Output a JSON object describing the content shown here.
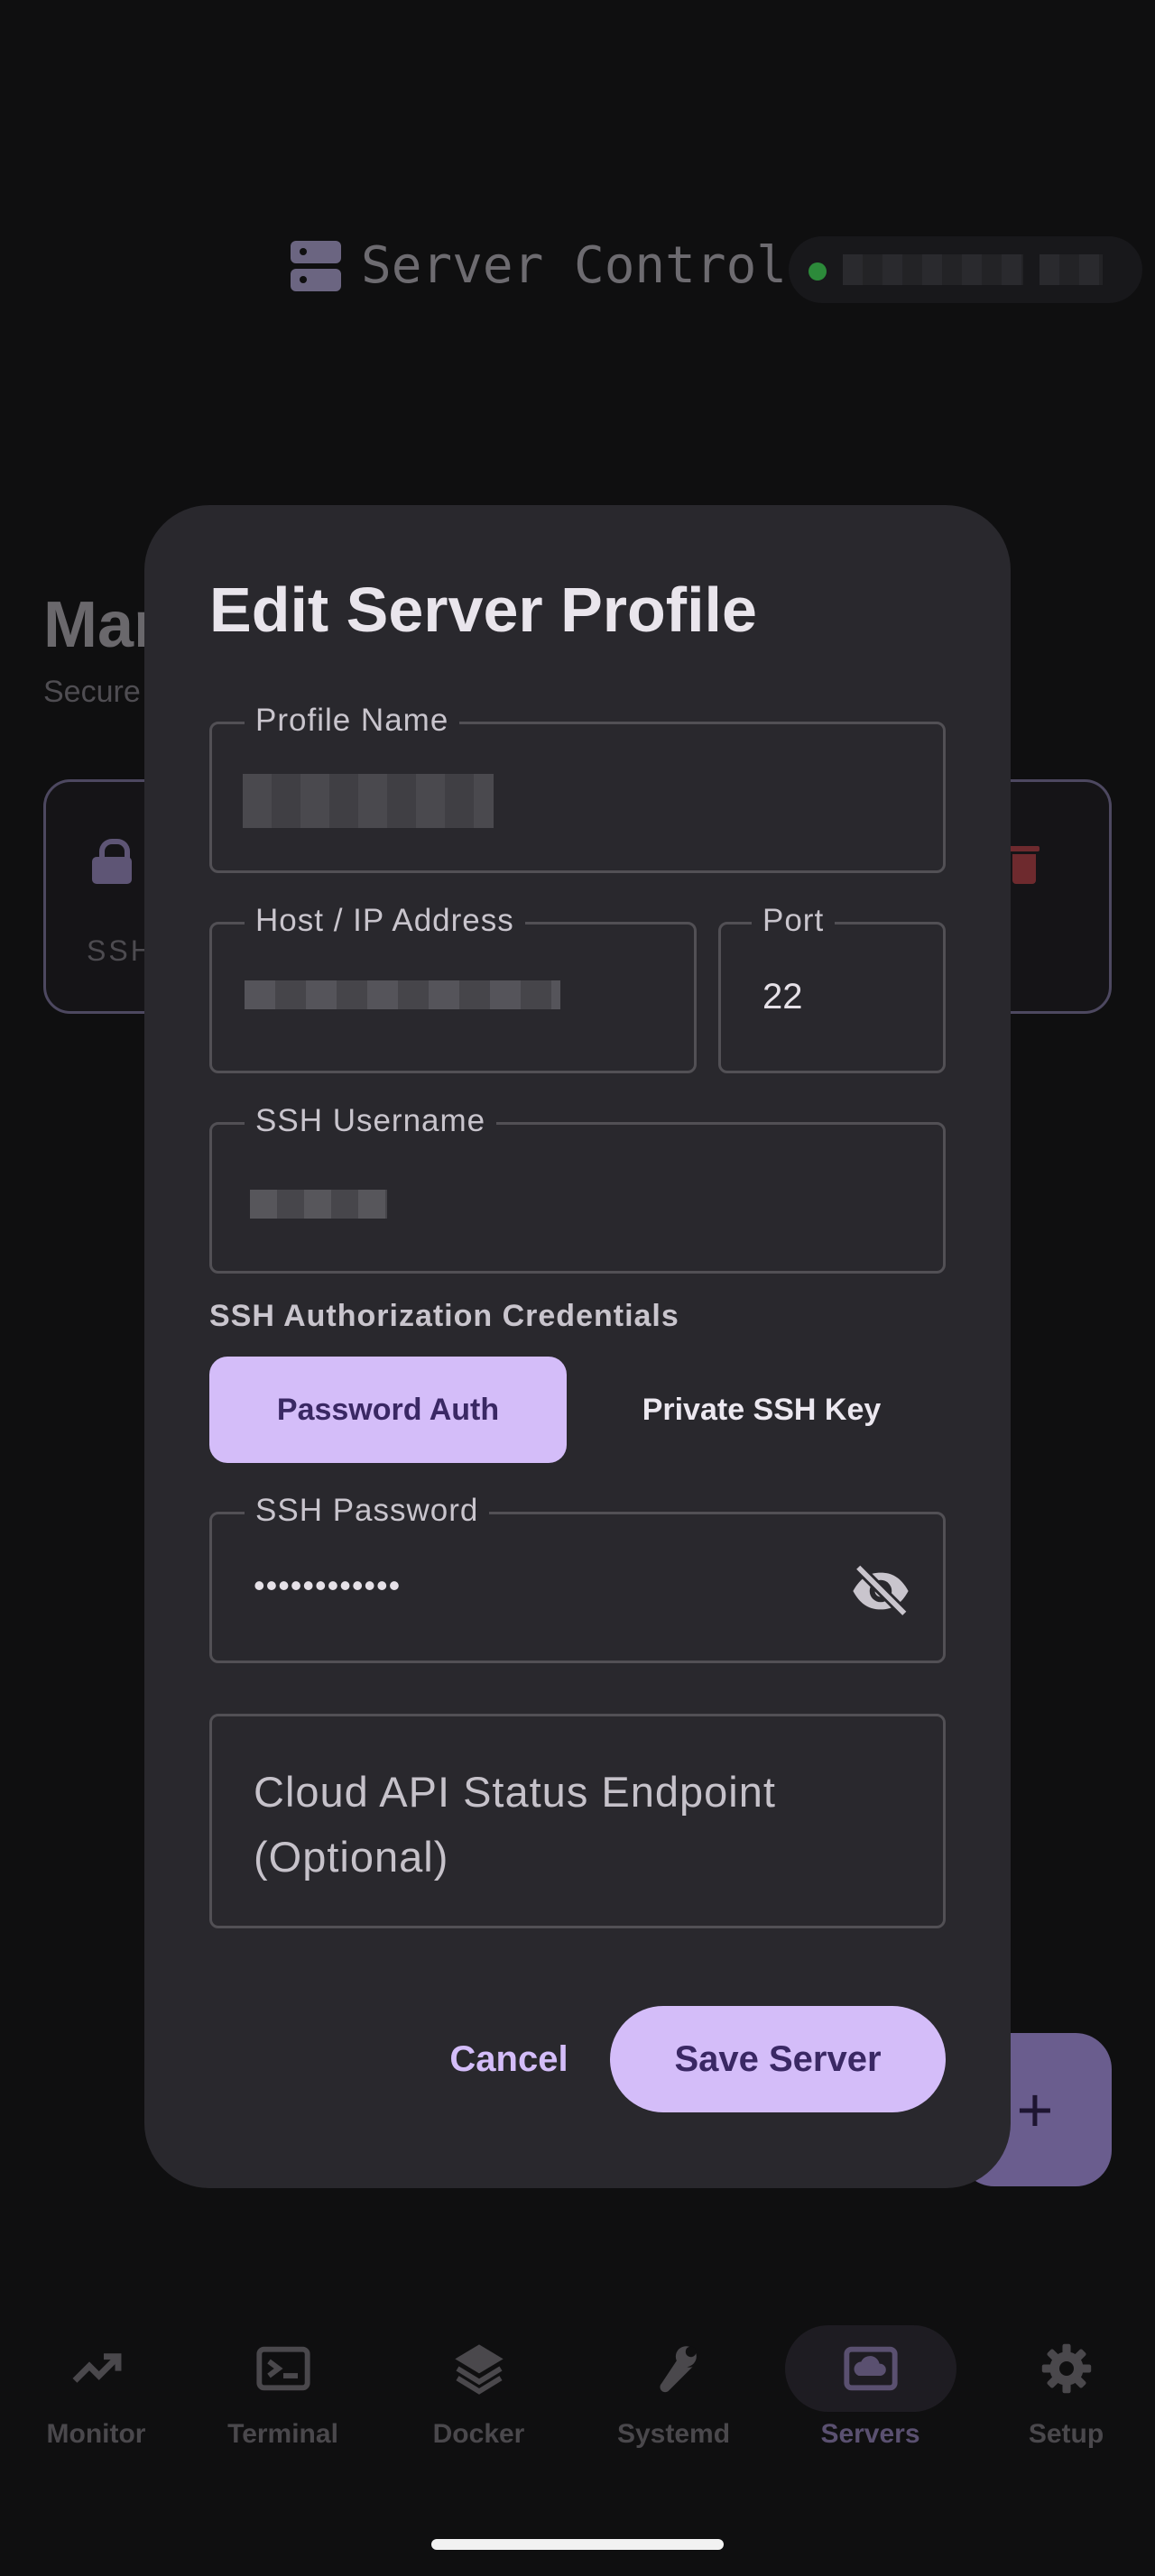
{
  "app_bar": {
    "title": "Server Control"
  },
  "background": {
    "heading_partial": "Mar",
    "subtitle_partial": "Secure",
    "card_label_partial": "SSH"
  },
  "dialog": {
    "title": "Edit Server Profile",
    "fields": {
      "profile_name": {
        "label": "Profile Name"
      },
      "host": {
        "label": "Host / IP Address"
      },
      "port": {
        "label": "Port",
        "value": "22"
      },
      "username": {
        "label": "SSH Username"
      },
      "password": {
        "label": "SSH Password",
        "value": "••••••••••••"
      },
      "endpoint": {
        "placeholder": "Cloud API Status Endpoint (Optional)"
      }
    },
    "auth_section_label": "SSH Authorization Credentials",
    "auth_options": [
      "Password Auth",
      "Private SSH Key"
    ],
    "auth_selected": "Password Auth",
    "cancel_label": "Cancel",
    "save_label": "Save Server"
  },
  "fab": {
    "label": "+"
  },
  "nav": {
    "items": [
      {
        "label": "Monitor",
        "icon": "trending-up-icon"
      },
      {
        "label": "Terminal",
        "icon": "terminal-icon"
      },
      {
        "label": "Docker",
        "icon": "layers-icon"
      },
      {
        "label": "Systemd",
        "icon": "wrench-icon"
      },
      {
        "label": "Servers",
        "icon": "cloud-server-icon"
      },
      {
        "label": "Setup",
        "icon": "gear-icon"
      }
    ],
    "active": "Servers"
  },
  "colors": {
    "accent": "#d4bdf9",
    "dialog_bg": "#29282d",
    "background": "#0f0f10",
    "status_online": "#2c8a3a"
  }
}
